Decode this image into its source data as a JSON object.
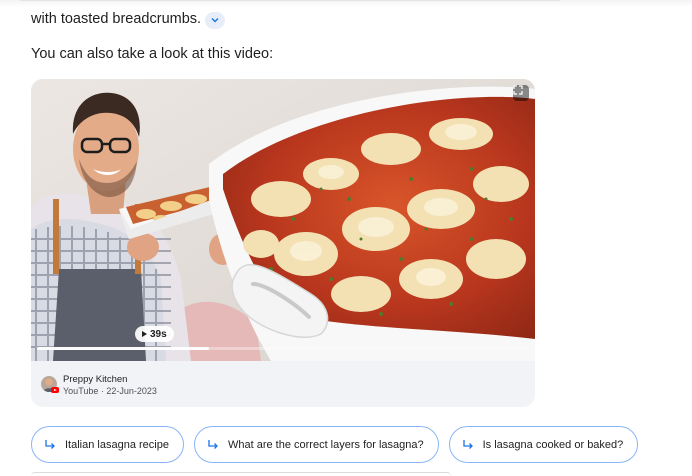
{
  "answer": {
    "line_tail": "with toasted breadcrumbs.",
    "video_intro": "You can also take a look at this video:"
  },
  "video": {
    "duration": "39s",
    "progress_fraction": 0.35,
    "channel": "Preppy Kitchen",
    "meta": "YouTube · 22-Jun-2023"
  },
  "suggestions": [
    {
      "label": "Italian lasagna recipe"
    },
    {
      "label": "What are the correct layers for lasagna?"
    },
    {
      "label": "Is lasagna cooked or baked?"
    }
  ],
  "colors": {
    "accent_border": "#8ab4f8",
    "chip_arrow": "#1a73e8",
    "expand_pill_bg": "#e8eef9"
  }
}
